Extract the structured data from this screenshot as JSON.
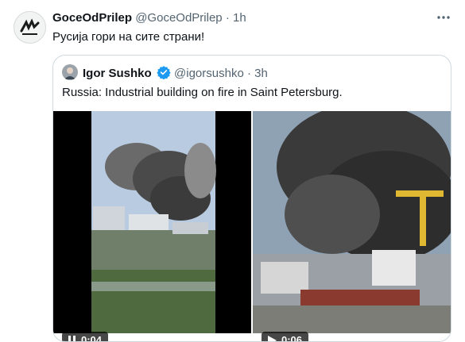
{
  "tweet": {
    "display_name": "GoceOdPrilep",
    "handle": "@GoceOdPrilep",
    "separator": "·",
    "time": "1h",
    "text": "Русија гори на сите страни!",
    "more_icon": "more-icon"
  },
  "quoted_tweet": {
    "display_name": "Igor Sushko",
    "verified": true,
    "handle": "@igorsushko",
    "separator": "·",
    "time": "3h",
    "text": "Russia: Industrial building on fire in Saint Petersburg."
  },
  "media": [
    {
      "kind": "video",
      "state": "playing",
      "icon": "pause-icon",
      "timestamp": "0:04"
    },
    {
      "kind": "video",
      "state": "paused",
      "icon": "play-icon",
      "timestamp": "0:06"
    }
  ],
  "colors": {
    "text_primary": "#0f1419",
    "text_secondary": "#536471",
    "border": "#cfd9de",
    "verified_blue": "#1d9bf0"
  }
}
